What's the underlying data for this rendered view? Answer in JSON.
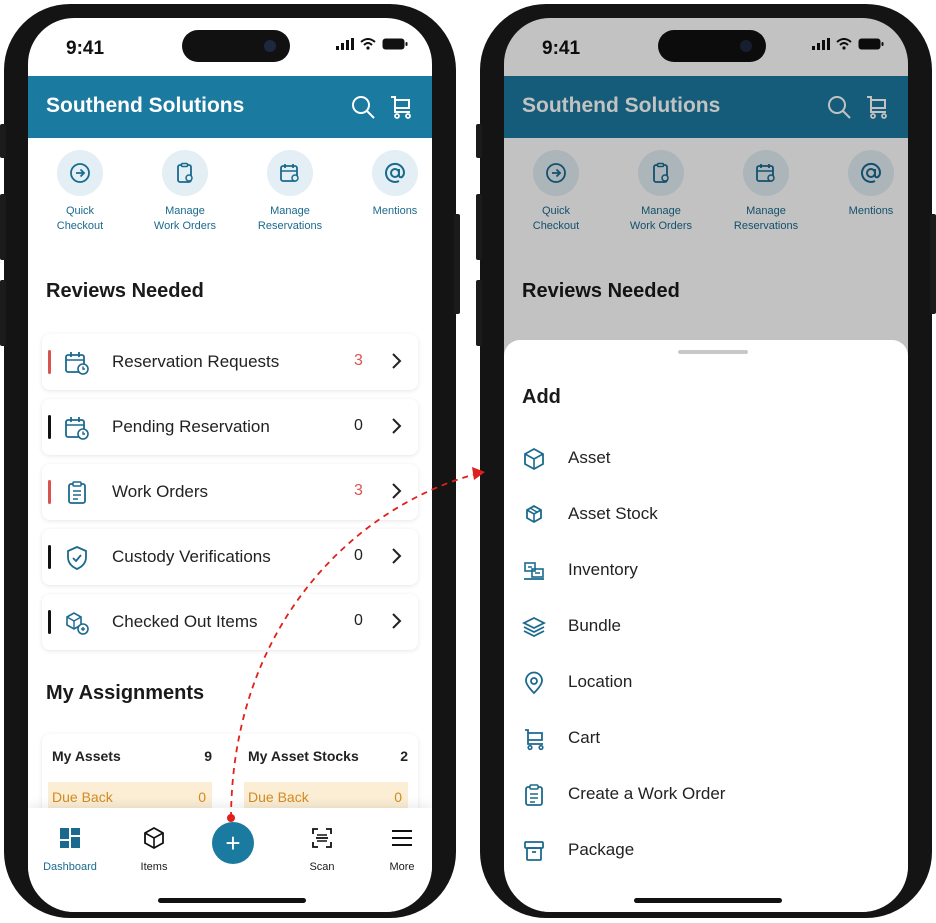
{
  "status": {
    "time": "9:41"
  },
  "app": {
    "title": "Southend Solutions"
  },
  "quick_actions": [
    {
      "label": "Quick\nCheckout",
      "icon": "arrow-right-circle-icon"
    },
    {
      "label": "Manage\nWork Orders",
      "icon": "clipboard-gear-icon"
    },
    {
      "label": "Manage\nReservations",
      "icon": "calendar-gear-icon"
    },
    {
      "label": "Mentions",
      "icon": "at-icon"
    }
  ],
  "reviews": {
    "title": "Reviews Needed",
    "items": [
      {
        "label": "Reservation Requests",
        "count": "3",
        "accent": "#d9534f",
        "icon": "calendar-clock-icon"
      },
      {
        "label": "Pending Reservation",
        "count": "0",
        "accent": "#111111",
        "icon": "calendar-clock-icon"
      },
      {
        "label": "Work Orders",
        "count": "3",
        "accent": "#d9534f",
        "icon": "clipboard-list-icon"
      },
      {
        "label": "Custody Verifications",
        "count": "0",
        "accent": "#111111",
        "icon": "shield-check-icon"
      },
      {
        "label": "Checked Out Items",
        "count": "0",
        "accent": "#111111",
        "icon": "boxes-out-icon"
      }
    ]
  },
  "assignments": {
    "title": "My Assignments",
    "cards": [
      {
        "name": "My Assets",
        "count": "9",
        "due_label": "Due Back",
        "due_count": "0"
      },
      {
        "name": "My Asset Stocks",
        "count": "2",
        "due_label": "Due Back",
        "due_count": "0"
      }
    ]
  },
  "nav": {
    "items": [
      {
        "label": "Dashboard",
        "icon": "dashboard-icon"
      },
      {
        "label": "Items",
        "icon": "box-icon"
      },
      {
        "label": "Scan",
        "icon": "scan-icon"
      },
      {
        "label": "More",
        "icon": "menu-icon"
      }
    ],
    "fab_symbol": "+"
  },
  "add_sheet": {
    "title": "Add",
    "items": [
      {
        "label": "Asset",
        "icon": "cube-icon"
      },
      {
        "label": "Asset Stock",
        "icon": "cubes-icon"
      },
      {
        "label": "Inventory",
        "icon": "inventory-icon"
      },
      {
        "label": "Bundle",
        "icon": "layers-icon"
      },
      {
        "label": "Location",
        "icon": "location-pin-icon"
      },
      {
        "label": "Cart",
        "icon": "cart-icon"
      },
      {
        "label": "Create a Work Order",
        "icon": "clipboard-list-icon"
      },
      {
        "label": "Package",
        "icon": "archive-box-icon"
      }
    ]
  },
  "colors": {
    "brand": "#1b7aa0",
    "alert": "#d9534f",
    "due_bg": "#fbeed4",
    "due_text": "#d28b22",
    "connector": "#e0201c"
  }
}
